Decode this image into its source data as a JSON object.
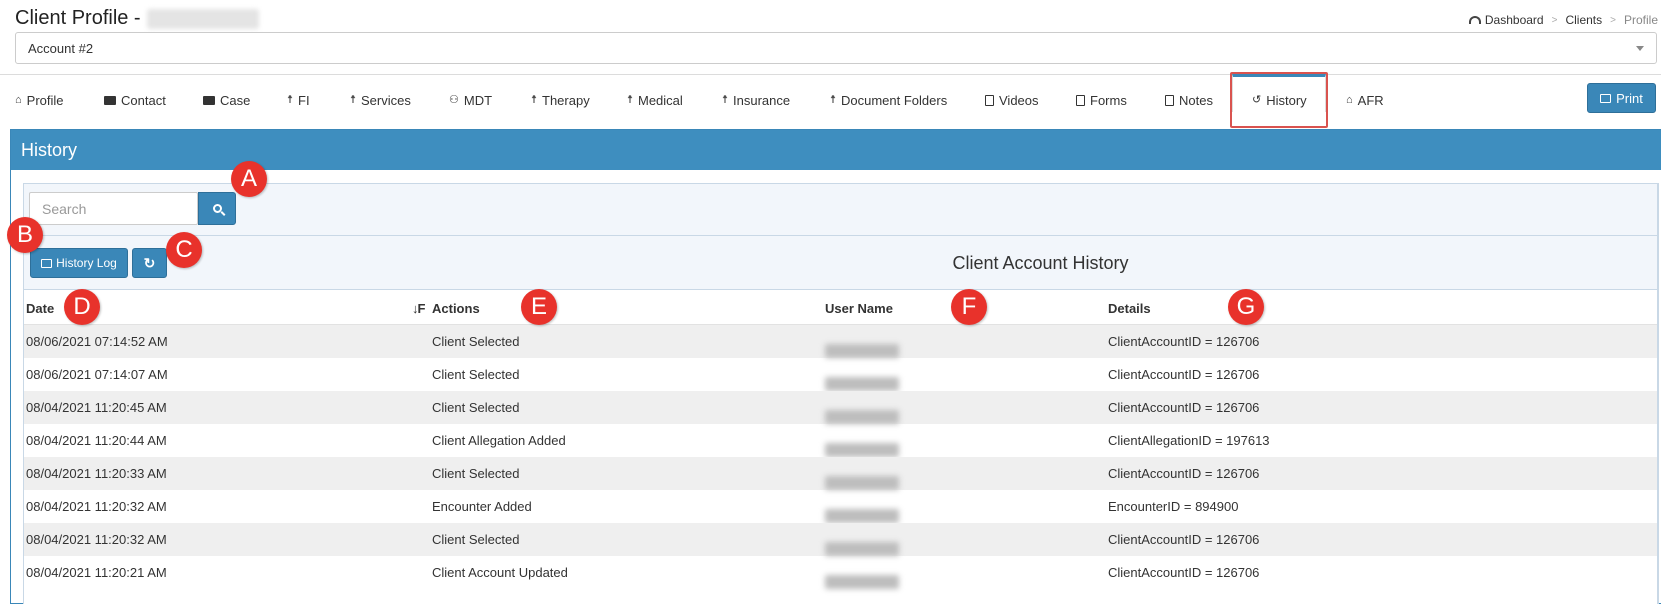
{
  "header": {
    "title": "Client Profile - ",
    "breadcrumb": {
      "dashboard": "Dashboard",
      "sep": ">",
      "clients": "Clients",
      "current": "Profile"
    }
  },
  "account_select": {
    "value": "Account #2"
  },
  "tabs": [
    {
      "label": "Profile",
      "icon": "home-icon",
      "glyph": "⌂"
    },
    {
      "label": "Contact",
      "icon": "address-card-icon",
      "glyph": ""
    },
    {
      "label": "Case",
      "icon": "briefcase-icon",
      "glyph": ""
    },
    {
      "label": "FI",
      "icon": "person-icon",
      "glyph": "☨"
    },
    {
      "label": "Services",
      "icon": "person-icon",
      "glyph": "☨"
    },
    {
      "label": "MDT",
      "icon": "users-icon",
      "glyph": "⚇"
    },
    {
      "label": "Therapy",
      "icon": "person-icon",
      "glyph": "☨"
    },
    {
      "label": "Medical",
      "icon": "person-icon",
      "glyph": "☨"
    },
    {
      "label": "Insurance",
      "icon": "person-icon",
      "glyph": "☨"
    },
    {
      "label": "Document Folders",
      "icon": "person-icon",
      "glyph": "☨"
    },
    {
      "label": "Videos",
      "icon": "file-video-icon",
      "glyph": ""
    },
    {
      "label": "Forms",
      "icon": "file-icon",
      "glyph": ""
    },
    {
      "label": "Notes",
      "icon": "file-icon",
      "glyph": ""
    },
    {
      "label": "History",
      "icon": "history-icon",
      "glyph": "↺"
    },
    {
      "label": "AFR",
      "icon": "home-icon",
      "glyph": "⌂"
    }
  ],
  "print_button": {
    "label": "Print",
    "icon": "print-icon"
  },
  "panel": {
    "title": "History"
  },
  "search": {
    "placeholder": "Search",
    "icon": "search-icon"
  },
  "toolbar": {
    "history_log_label": "History Log",
    "history_log_icon": "print-icon",
    "refresh_icon": "refresh-icon",
    "refresh_glyph": "↻",
    "table_title": "Client Account History"
  },
  "table": {
    "columns": {
      "date": "Date",
      "actions": "Actions",
      "user_name": "User Name",
      "details": "Details"
    },
    "sort_glyph": "↓F",
    "rows": [
      {
        "date": "08/06/2021 07:14:52 AM",
        "action": "Client Selected",
        "details": "ClientAccountID = 126706"
      },
      {
        "date": "08/06/2021 07:14:07 AM",
        "action": "Client Selected",
        "details": "ClientAccountID = 126706"
      },
      {
        "date": "08/04/2021 11:20:45 AM",
        "action": "Client Selected",
        "details": "ClientAccountID = 126706"
      },
      {
        "date": "08/04/2021 11:20:44 AM",
        "action": "Client Allegation Added",
        "details": "ClientAllegationID = 197613"
      },
      {
        "date": "08/04/2021 11:20:33 AM",
        "action": "Client Selected",
        "details": "ClientAccountID = 126706"
      },
      {
        "date": "08/04/2021 11:20:32 AM",
        "action": "Encounter Added",
        "details": "EncounterID = 894900"
      },
      {
        "date": "08/04/2021 11:20:32 AM",
        "action": "Client Selected",
        "details": "ClientAccountID = 126706"
      },
      {
        "date": "08/04/2021 11:20:21 AM",
        "action": "Client Account Updated",
        "details": "ClientAccountID = 126706"
      }
    ]
  },
  "markers": [
    "A",
    "B",
    "C",
    "D",
    "E",
    "F",
    "G"
  ],
  "colors": {
    "accent": "#3a87b8",
    "panel_header": "#3e8ebf",
    "marker": "#e8322b",
    "highlight": "#d9534f"
  }
}
